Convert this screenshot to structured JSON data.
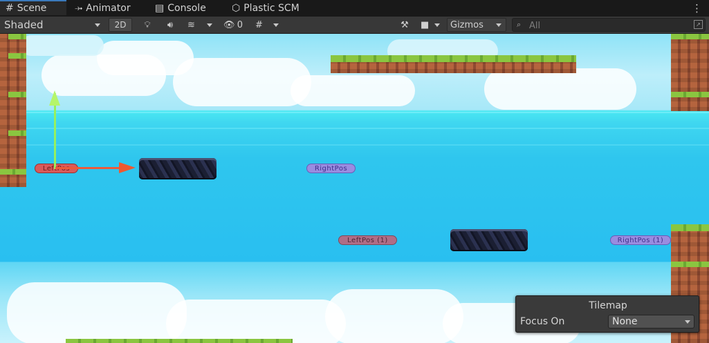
{
  "tabs": [
    {
      "label": "Scene",
      "icon": "grid-icon",
      "active": true
    },
    {
      "label": "Animator",
      "icon": "animator-icon",
      "active": false
    },
    {
      "label": "Console",
      "icon": "console-icon",
      "active": false
    },
    {
      "label": "Plastic SCM",
      "icon": "plastic-scm-icon",
      "active": false
    }
  ],
  "toolbar": {
    "shading_mode": "Shaded",
    "toggle_2d": "2D",
    "hidden_count": "0",
    "gizmos_label": "Gizmos",
    "search_placeholder": "All"
  },
  "scene": {
    "markers": {
      "left_pos": "LeftPos",
      "right_pos": "RightPos",
      "left_pos_1": "LeftPos (1)",
      "right_pos_1": "RightPos (1)"
    }
  },
  "overlay": {
    "title": "Tilemap",
    "focus_label": "Focus On",
    "focus_value": "None"
  },
  "colors": {
    "tab_accent": "#3a79bb",
    "sky": "#8fe3f7",
    "water": "#29bff0",
    "gizmo_x": "#ef5830",
    "gizmo_y": "#96f05f"
  }
}
